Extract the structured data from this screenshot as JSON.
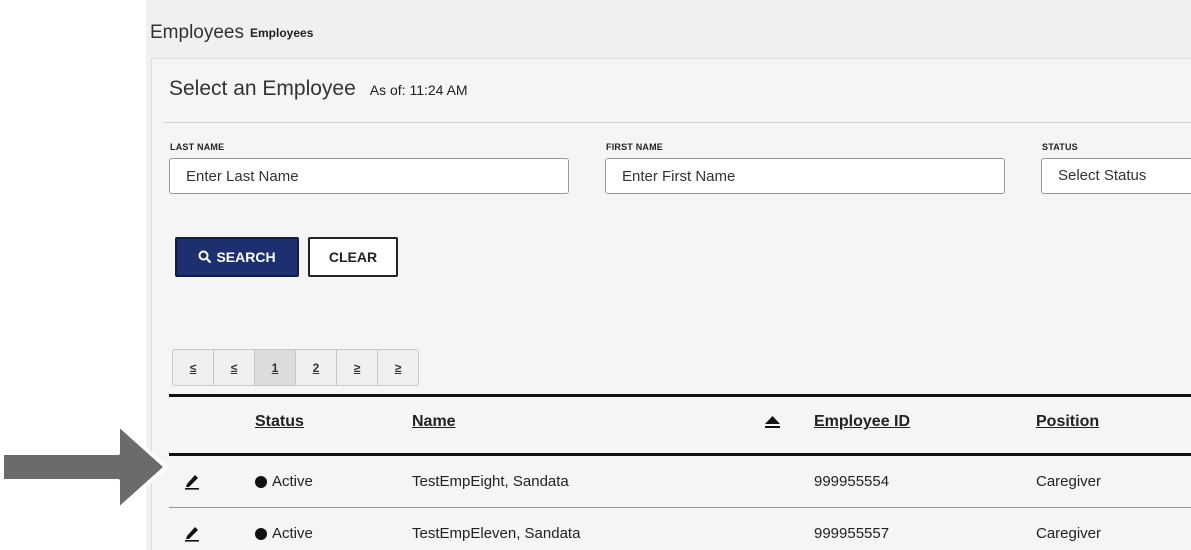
{
  "header": {
    "title": "Employees",
    "subtitle": "Employees"
  },
  "panel": {
    "title": "Select an Employee",
    "as_of": "As of: 11:24 AM"
  },
  "filters": {
    "last_name": {
      "label": "LAST NAME",
      "placeholder": "Enter Last Name"
    },
    "first_name": {
      "label": "FIRST NAME",
      "placeholder": "Enter First Name"
    },
    "status": {
      "label": "STATUS",
      "selected": "Select Status"
    }
  },
  "buttons": {
    "search": "SEARCH",
    "clear": "CLEAR",
    "search_icon": "search-icon"
  },
  "pagination": {
    "first": "≤",
    "prev": "≤",
    "pages": [
      "1",
      "2"
    ],
    "current_page": "1",
    "next": "≥",
    "last": "≥"
  },
  "table": {
    "columns": {
      "status": "Status",
      "name": "Name",
      "employee_id": "Employee ID",
      "position": "Position"
    },
    "sort_icon": "caret-up-icon",
    "rows": [
      {
        "status": "Active",
        "name": "TestEmpEight, Sandata",
        "employee_id": "999955554",
        "position": "Caregiver"
      },
      {
        "status": "Active",
        "name": "TestEmpEleven, Sandata",
        "employee_id": "999955557",
        "position": "Caregiver"
      }
    ]
  },
  "colors": {
    "accent": "#1e2f6f",
    "arrow": "#6b6b6b"
  }
}
